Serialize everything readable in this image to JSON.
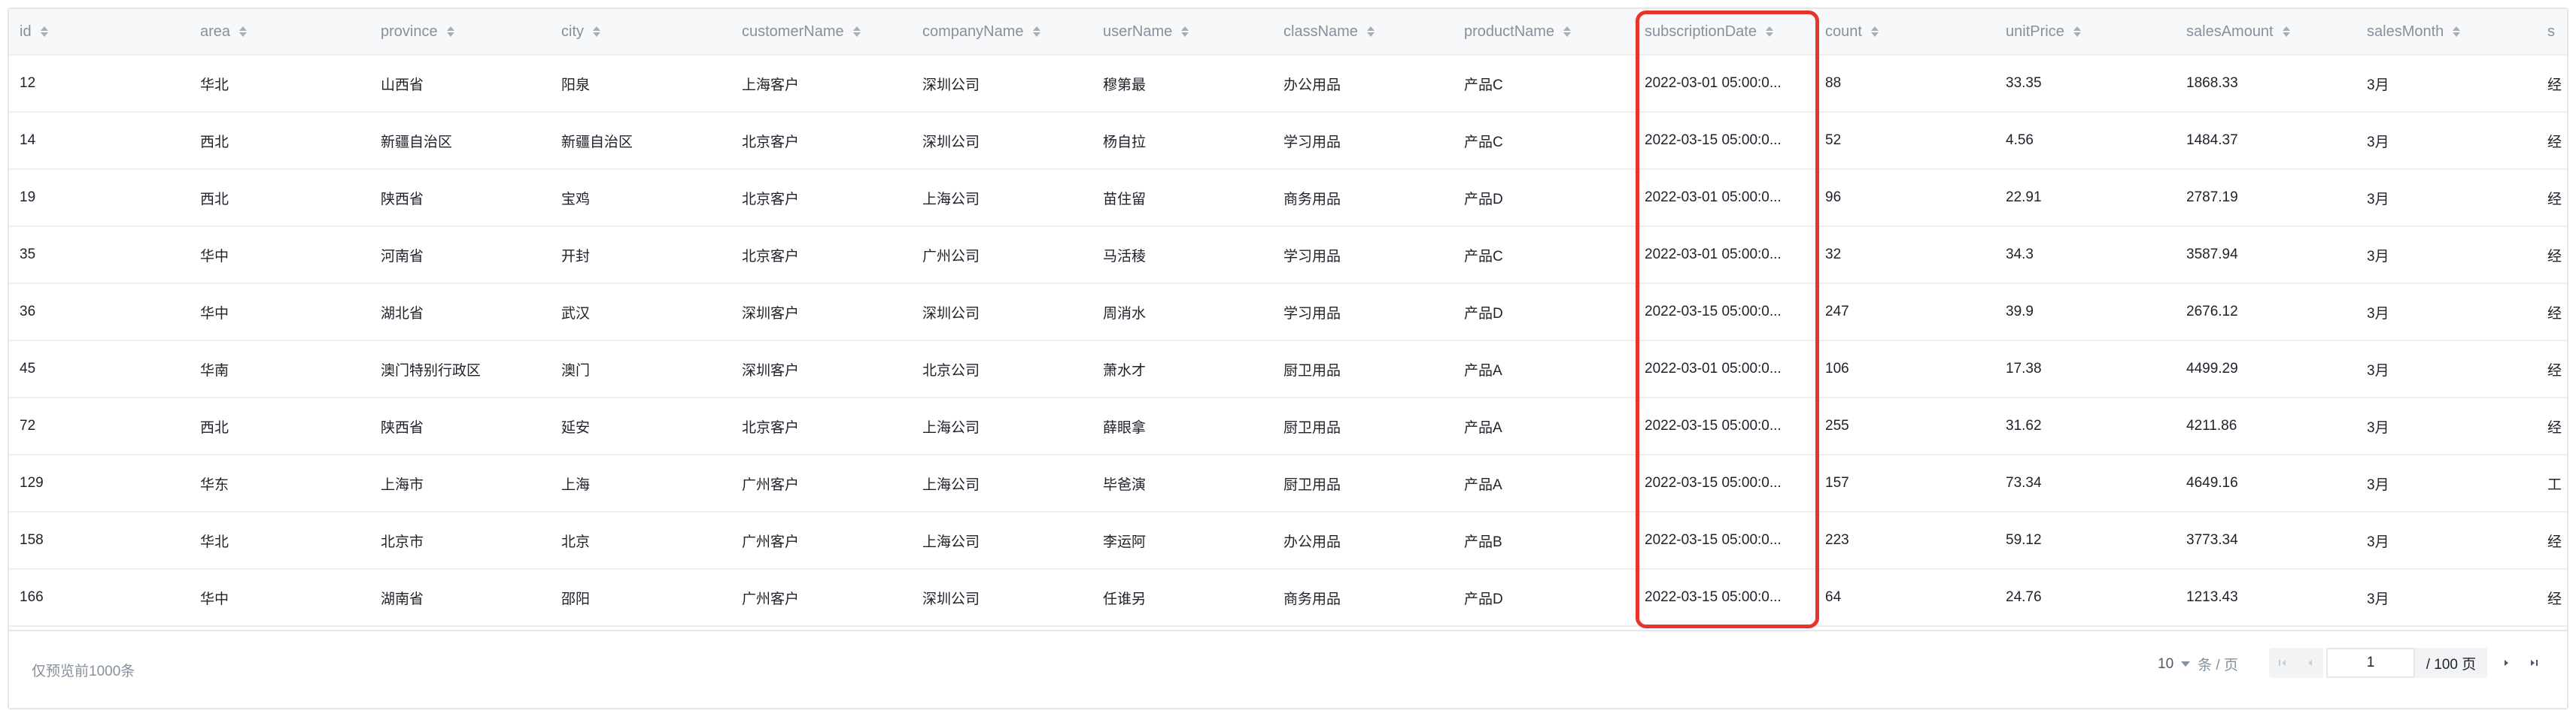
{
  "table": {
    "columns": [
      {
        "key": "id",
        "label": "id"
      },
      {
        "key": "area",
        "label": "area"
      },
      {
        "key": "province",
        "label": "province"
      },
      {
        "key": "city",
        "label": "city"
      },
      {
        "key": "customerName",
        "label": "customerName"
      },
      {
        "key": "companyName",
        "label": "companyName"
      },
      {
        "key": "userName",
        "label": "userName"
      },
      {
        "key": "className",
        "label": "className"
      },
      {
        "key": "productName",
        "label": "productName"
      },
      {
        "key": "subscriptionDate",
        "label": "subscriptionDate"
      },
      {
        "key": "count",
        "label": "count"
      },
      {
        "key": "unitPrice",
        "label": "unitPrice"
      },
      {
        "key": "salesAmount",
        "label": "salesAmount"
      },
      {
        "key": "salesMonth",
        "label": "salesMonth"
      },
      {
        "key": "col15",
        "label": "s"
      }
    ],
    "highlighted_column": "subscriptionDate",
    "rows": [
      {
        "id": "12",
        "area": "华北",
        "province": "山西省",
        "city": "阳泉",
        "customerName": "上海客户",
        "companyName": "深圳公司",
        "userName": "穆第最",
        "className": "办公用品",
        "productName": "产品C",
        "subscriptionDate": "2022-03-01 05:00:0...",
        "count": "88",
        "unitPrice": "33.35",
        "salesAmount": "1868.33",
        "salesMonth": "3月",
        "col15": "经"
      },
      {
        "id": "14",
        "area": "西北",
        "province": "新疆自治区",
        "city": "新疆自治区",
        "customerName": "北京客户",
        "companyName": "深圳公司",
        "userName": "杨自拉",
        "className": "学习用品",
        "productName": "产品C",
        "subscriptionDate": "2022-03-15 05:00:0...",
        "count": "52",
        "unitPrice": "4.56",
        "salesAmount": "1484.37",
        "salesMonth": "3月",
        "col15": "经"
      },
      {
        "id": "19",
        "area": "西北",
        "province": "陕西省",
        "city": "宝鸡",
        "customerName": "北京客户",
        "companyName": "上海公司",
        "userName": "苗住留",
        "className": "商务用品",
        "productName": "产品D",
        "subscriptionDate": "2022-03-01 05:00:0...",
        "count": "96",
        "unitPrice": "22.91",
        "salesAmount": "2787.19",
        "salesMonth": "3月",
        "col15": "经"
      },
      {
        "id": "35",
        "area": "华中",
        "province": "河南省",
        "city": "开封",
        "customerName": "北京客户",
        "companyName": "广州公司",
        "userName": "马活稜",
        "className": "学习用品",
        "productName": "产品C",
        "subscriptionDate": "2022-03-01 05:00:0...",
        "count": "32",
        "unitPrice": "34.3",
        "salesAmount": "3587.94",
        "salesMonth": "3月",
        "col15": "经"
      },
      {
        "id": "36",
        "area": "华中",
        "province": "湖北省",
        "city": "武汉",
        "customerName": "深圳客户",
        "companyName": "深圳公司",
        "userName": "周消水",
        "className": "学习用品",
        "productName": "产品D",
        "subscriptionDate": "2022-03-15 05:00:0...",
        "count": "247",
        "unitPrice": "39.9",
        "salesAmount": "2676.12",
        "salesMonth": "3月",
        "col15": "经"
      },
      {
        "id": "45",
        "area": "华南",
        "province": "澳门特别行政区",
        "city": "澳门",
        "customerName": "深圳客户",
        "companyName": "北京公司",
        "userName": "萧水才",
        "className": "厨卫用品",
        "productName": "产品A",
        "subscriptionDate": "2022-03-01 05:00:0...",
        "count": "106",
        "unitPrice": "17.38",
        "salesAmount": "4499.29",
        "salesMonth": "3月",
        "col15": "经"
      },
      {
        "id": "72",
        "area": "西北",
        "province": "陕西省",
        "city": "延安",
        "customerName": "北京客户",
        "companyName": "上海公司",
        "userName": "薛眼拿",
        "className": "厨卫用品",
        "productName": "产品A",
        "subscriptionDate": "2022-03-15 05:00:0...",
        "count": "255",
        "unitPrice": "31.62",
        "salesAmount": "4211.86",
        "salesMonth": "3月",
        "col15": "经"
      },
      {
        "id": "129",
        "area": "华东",
        "province": "上海市",
        "city": "上海",
        "customerName": "广州客户",
        "companyName": "上海公司",
        "userName": "毕爸演",
        "className": "厨卫用品",
        "productName": "产品A",
        "subscriptionDate": "2022-03-15 05:00:0...",
        "count": "157",
        "unitPrice": "73.34",
        "salesAmount": "4649.16",
        "salesMonth": "3月",
        "col15": "工"
      },
      {
        "id": "158",
        "area": "华北",
        "province": "北京市",
        "city": "北京",
        "customerName": "广州客户",
        "companyName": "上海公司",
        "userName": "李运阿",
        "className": "办公用品",
        "productName": "产品B",
        "subscriptionDate": "2022-03-15 05:00:0...",
        "count": "223",
        "unitPrice": "59.12",
        "salesAmount": "3773.34",
        "salesMonth": "3月",
        "col15": "经"
      },
      {
        "id": "166",
        "area": "华中",
        "province": "湖南省",
        "city": "邵阳",
        "customerName": "广州客户",
        "companyName": "深圳公司",
        "userName": "任谁另",
        "className": "商务用品",
        "productName": "产品D",
        "subscriptionDate": "2022-03-15 05:00:0...",
        "count": "64",
        "unitPrice": "24.76",
        "salesAmount": "1213.43",
        "salesMonth": "3月",
        "col15": "经"
      }
    ]
  },
  "footer": {
    "note": "仅预览前1000条",
    "page_size": "10",
    "page_size_unit": "条 / 页",
    "current_page": "1",
    "total_pages_label": "/ 100 页"
  },
  "colors": {
    "highlight": "#e8342a",
    "header_bg": "#f7f8fa",
    "border": "#e5e6eb"
  }
}
